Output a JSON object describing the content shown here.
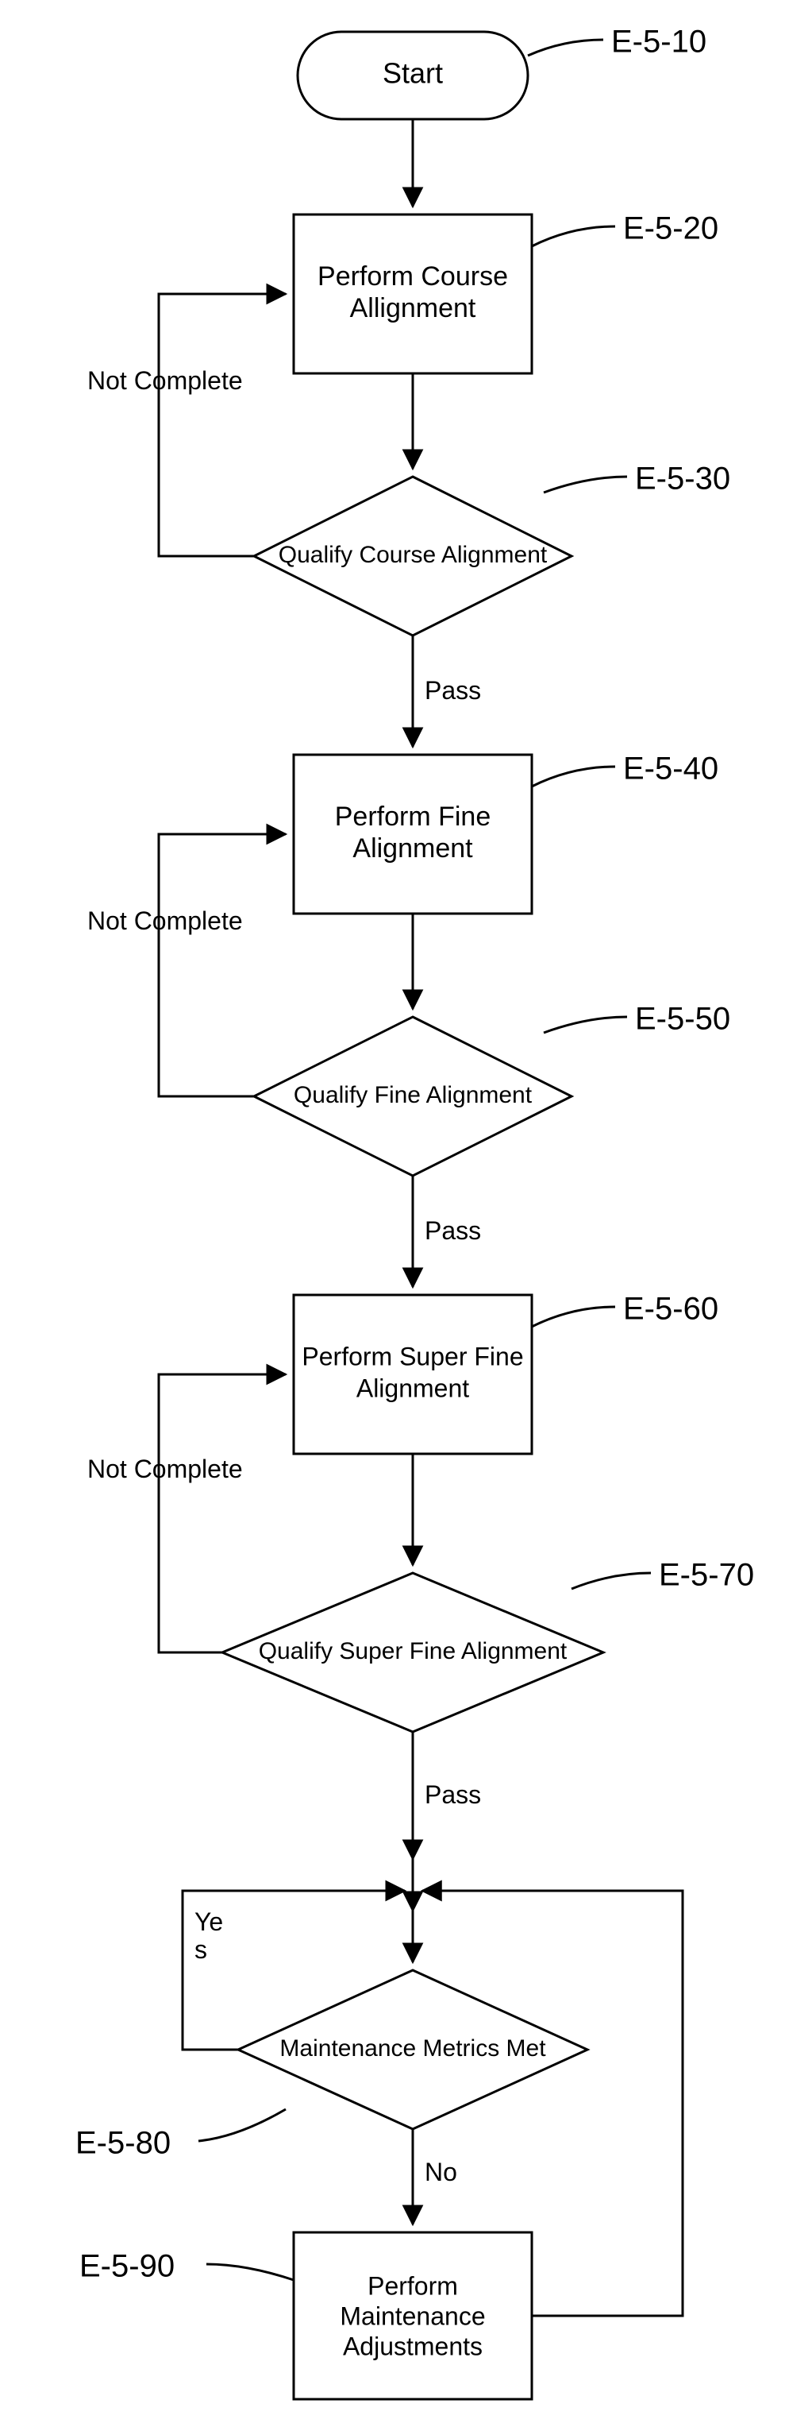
{
  "nodes": {
    "start": {
      "label": "Start",
      "ref": "E-5-10"
    },
    "n20": {
      "label1": "Perform Course",
      "label2": "Allignment",
      "ref": "E-5-20"
    },
    "n30": {
      "label": "Qualify Course Alignment",
      "ref": "E-5-30"
    },
    "n40": {
      "label1": "Perform Fine",
      "label2": "Alignment",
      "ref": "E-5-40"
    },
    "n50": {
      "label": "Qualify Fine Alignment",
      "ref": "E-5-50"
    },
    "n60": {
      "label1": "Perform Super Fine",
      "label2": "Alignment",
      "ref": "E-5-60"
    },
    "n70": {
      "label": "Qualify Super Fine Alignment",
      "ref": "E-5-70"
    },
    "n80": {
      "label": "Maintenance Metrics Met",
      "ref": "E-5-80"
    },
    "n90": {
      "label1": "Perform",
      "label2": "Maintenance",
      "label3": "Adjustments",
      "ref": "E-5-90"
    }
  },
  "edges": {
    "not_complete": "Not Complete",
    "pass": "Pass",
    "yes1": "Ye",
    "yes2": "s",
    "no": "No"
  }
}
